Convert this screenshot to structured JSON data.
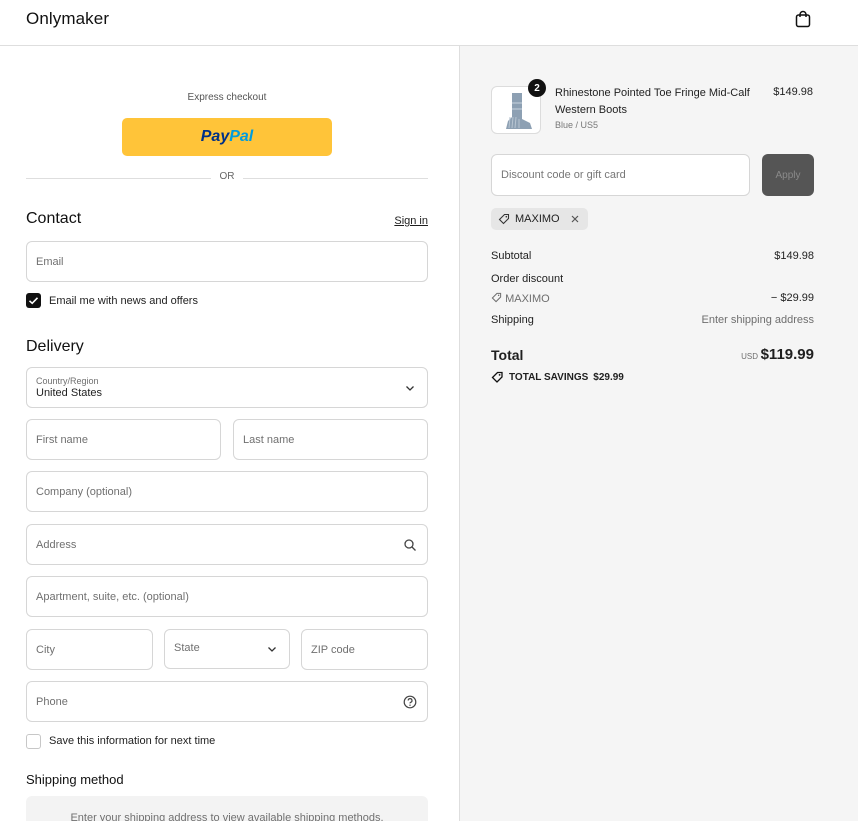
{
  "header": {
    "brand": "Onlymaker",
    "cart_icon": "shopping-bag-icon"
  },
  "express": {
    "label": "Express checkout",
    "paypal_part1": "Pay",
    "paypal_part2": "Pal",
    "or": "OR"
  },
  "contact": {
    "title": "Contact",
    "signin": "Sign in",
    "email_placeholder": "Email",
    "news_label": "Email me with news and offers",
    "news_checked": true
  },
  "delivery": {
    "title": "Delivery",
    "country_label": "Country/Region",
    "country_value": "United States",
    "first_name": "First name",
    "last_name": "Last name",
    "company": "Company (optional)",
    "address": "Address",
    "apartment": "Apartment, suite, etc. (optional)",
    "city": "City",
    "state": "State",
    "zip": "ZIP code",
    "phone": "Phone",
    "save_label": "Save this information for next time",
    "save_checked": false
  },
  "shipping_method": {
    "title": "Shipping method",
    "placeholder": "Enter your shipping address to view available shipping methods."
  },
  "summary": {
    "product": {
      "quantity": "2",
      "title": "Rhinestone Pointed Toe Fringe Mid-Calf Western Boots",
      "variant": "Blue / US5",
      "price": "$149.98"
    },
    "discount_placeholder": "Discount code or gift card",
    "apply": "Apply",
    "applied_code": "MAXIMO",
    "subtotal_label": "Subtotal",
    "subtotal": "$149.98",
    "order_discount_label": "Order discount",
    "discount_code": "MAXIMO",
    "discount_amount": "− $29.99",
    "shipping_label": "Shipping",
    "shipping_value": "Enter shipping address",
    "total_label": "Total",
    "currency": "USD",
    "total": "$119.99",
    "savings_label": "TOTAL SAVINGS",
    "savings": "$29.99"
  },
  "colors": {
    "paypal": "#ffc439",
    "apply_btn": "#555555",
    "summary_bg": "#f5f5f5"
  }
}
